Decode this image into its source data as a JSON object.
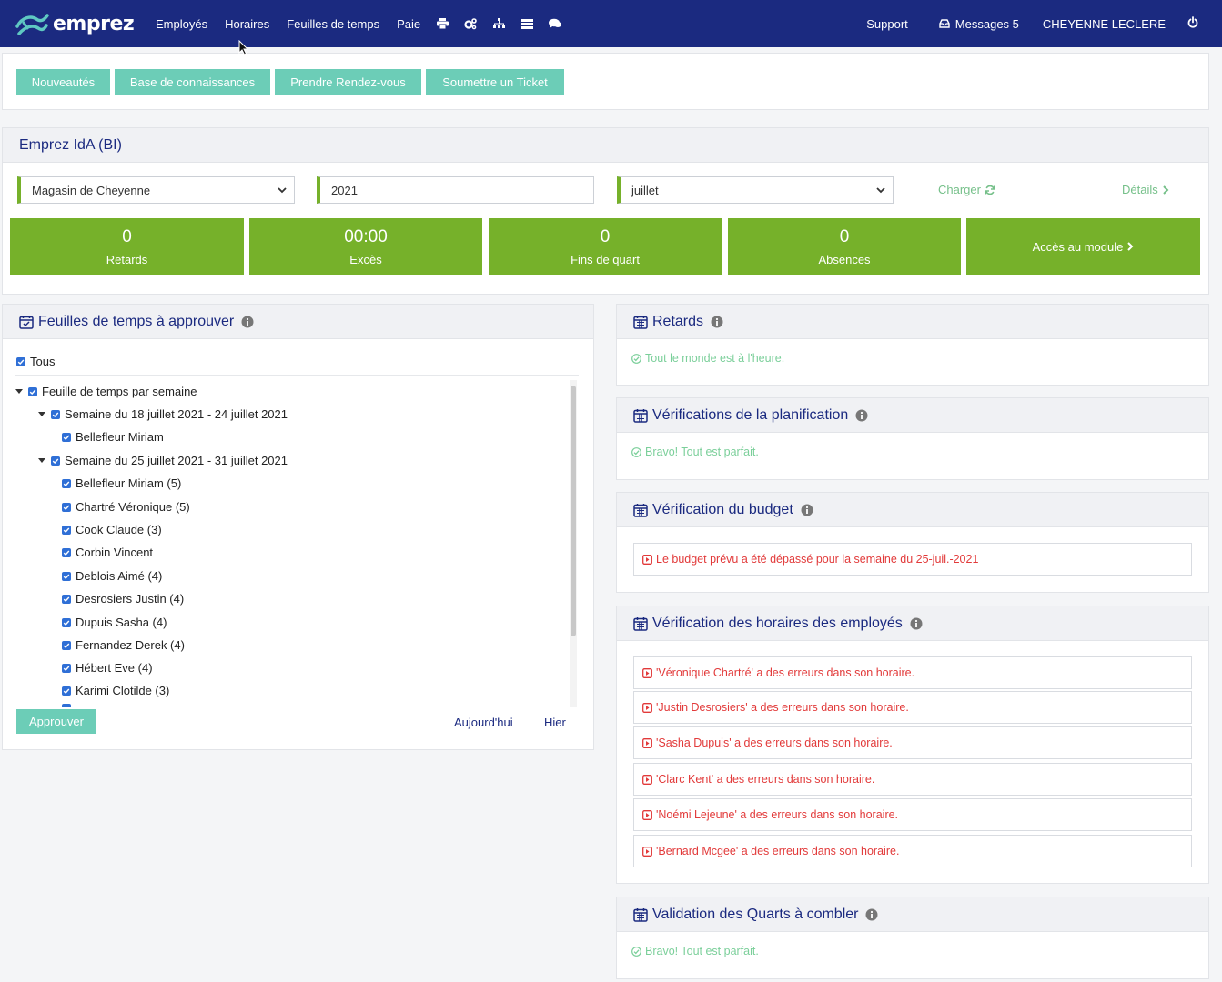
{
  "nav": {
    "logo_text": "emprez",
    "items": [
      "Employés",
      "Horaires",
      "Feuilles de temps",
      "Paie"
    ],
    "icons": [
      "print-icon",
      "cogs-icon",
      "sitemap-icon",
      "server-icon",
      "comments-icon"
    ],
    "support": "Support",
    "messages": "Messages 5",
    "user": "CHEYENNE LECLERE"
  },
  "toolbar": {
    "buttons": [
      "Nouveautés",
      "Base de connaissances",
      "Prendre Rendez-vous",
      "Soumettre un Ticket"
    ]
  },
  "bi": {
    "title": "Emprez IdA (BI)",
    "store": "Magasin de Cheyenne",
    "year": "2021",
    "month": "juillet",
    "load": "Charger",
    "details": "Détails",
    "tiles": [
      {
        "value": "0",
        "label": "Retards"
      },
      {
        "value": "00:00",
        "label": "Excès"
      },
      {
        "value": "0",
        "label": "Fins de quart"
      },
      {
        "value": "0",
        "label": "Absences"
      }
    ],
    "module": "Accès au module"
  },
  "timesheets": {
    "title": "Feuilles de temps à approuver",
    "all": "Tous",
    "root": "Feuille de temps par semaine",
    "week1": "Semaine du 18 juillet 2021 - 24 juillet 2021",
    "week1_items": [
      "Bellefleur Miriam"
    ],
    "week2": "Semaine du 25 juillet 2021 - 31 juillet 2021",
    "week2_items": [
      "Bellefleur Miriam (5)",
      "Chartré Véronique (5)",
      "Cook Claude (3)",
      "Corbin Vincent",
      "Deblois Aimé (4)",
      "Desrosiers Justin (4)",
      "Dupuis Sasha (4)",
      "Fernandez Derek (4)",
      "Hébert Eve (4)",
      "Karimi Clotilde (3)"
    ],
    "approve": "Approuver",
    "today": "Aujourd'hui",
    "yesterday": "Hier"
  },
  "retards": {
    "title": "Retards",
    "message": "Tout le monde est à l'heure."
  },
  "planif": {
    "title": "Vérifications de la planification",
    "message": "Bravo! Tout est parfait."
  },
  "budget": {
    "title": "Vérification du budget",
    "message": "Le budget prévu a été dépassé pour la semaine du 25-juil.-2021"
  },
  "horaires": {
    "title": "Vérification des horaires des employés",
    "errors": [
      "'Véronique Chartré' a des erreurs dans son horaire.",
      "'Justin Desrosiers' a des erreurs dans son horaire.",
      "'Sasha Dupuis' a des erreurs dans son horaire.",
      "'Clarc Kent' a des erreurs dans son horaire.",
      "'Noémi Lejeune' a des erreurs dans son horaire.",
      "'Bernard Mcgee' a des erreurs dans son horaire."
    ]
  },
  "quarts": {
    "title": "Validation des Quarts à combler",
    "message": "Bravo! Tout est parfait."
  },
  "colors": {
    "nav": "#1b2a80",
    "teal": "#6ccdb7",
    "green": "#76b12a",
    "ok": "#7bcf9a",
    "error": "#e23a3a"
  }
}
